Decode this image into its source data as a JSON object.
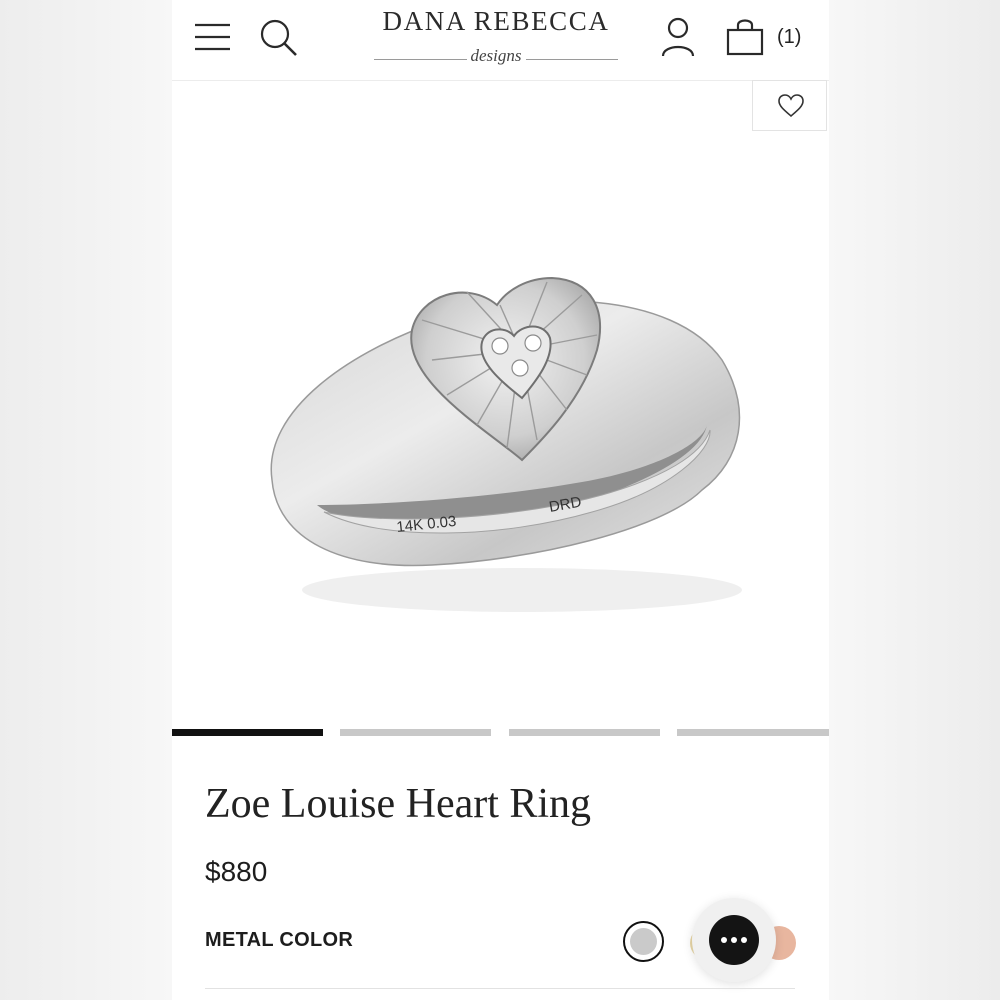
{
  "header": {
    "logo_main": "DANA REBECCA",
    "logo_sub": "designs",
    "cart_count": "(1)",
    "icons": [
      "menu-icon",
      "search-icon",
      "account-icon",
      "cart-icon"
    ]
  },
  "product": {
    "title": "Zoe Louise Heart Ring",
    "price": "$880",
    "image_engraving_left": "14K 0.03",
    "image_engraving_right": "DRD",
    "gallery": {
      "slide_count": 4,
      "active_slide": 1
    }
  },
  "options": {
    "metal_color_label": "METAL COLOR",
    "metal_colors": [
      {
        "name": "white",
        "hex": "#cacaca",
        "selected": true
      },
      {
        "name": "yellow",
        "hex": "#e7d6a6",
        "selected": false
      },
      {
        "name": "rose",
        "hex": "#e8b69f",
        "selected": false
      }
    ]
  },
  "colors": {
    "text": "#222222",
    "active_indicator": "#111111",
    "inactive_indicator": "#c8c8c8",
    "chat_bubble": "#141414"
  }
}
